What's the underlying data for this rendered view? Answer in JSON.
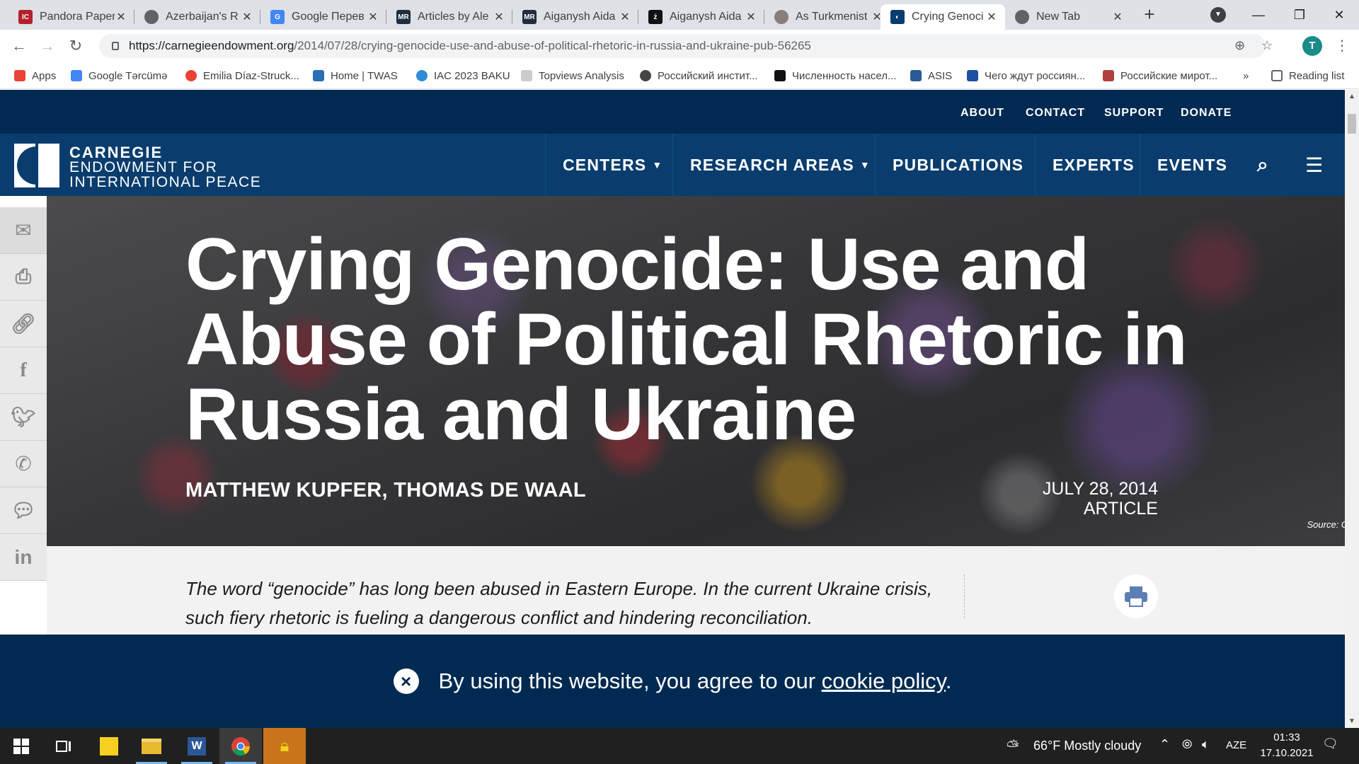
{
  "browser": {
    "tabs": [
      {
        "title": "Pandora Paper",
        "favicon": "ICIJ",
        "color": "#b3202c"
      },
      {
        "title": "Azerbaijan's R",
        "favicon": "globe-icon",
        "color": "#5f6368"
      },
      {
        "title": "Google Перев",
        "favicon": "google-translate-icon",
        "color": "#4285f4"
      },
      {
        "title": "Articles by Ale",
        "favicon": "MR",
        "color": "#1f2d3d"
      },
      {
        "title": "Aiganysh Aida",
        "favicon": "MR",
        "color": "#1f2d3d"
      },
      {
        "title": "Aiganysh Aida",
        "favicon": "ż",
        "color": "#111111"
      },
      {
        "title": "As Turkmenist",
        "favicon": "img",
        "color": "#8a7f78"
      },
      {
        "title": "Crying Genoci",
        "favicon": "carnegie",
        "color": "#0a3d6e",
        "active": true
      },
      {
        "title": "New Tab",
        "favicon": "chrome",
        "color": "#5f6368"
      }
    ],
    "url": {
      "host": "https://carnegieendowment.org",
      "path": "/2014/07/28/crying-genocide-use-and-abuse-of-political-rhetoric-in-russia-and-ukraine-pub-56265"
    },
    "profile_initial": "T",
    "bookmarks": [
      {
        "label": "Apps",
        "color": "#ea4335"
      },
      {
        "label": "Google Tərcümə",
        "color": "#4285f4"
      },
      {
        "label": "Emilia Díaz-Struck...",
        "color": "#ea4335"
      },
      {
        "label": "Home | TWAS",
        "color": "#2a6fb5"
      },
      {
        "label": "IAC 2023 BAKU",
        "color": "#2e8bd8"
      },
      {
        "label": "Topviews Analysis",
        "color": "#cccccc"
      },
      {
        "label": "Российский инстит...",
        "color": "#444444"
      },
      {
        "label": "Численность насел...",
        "color": "#111111"
      },
      {
        "label": "ASIS",
        "color": "#2a5a9a"
      },
      {
        "label": "Чего ждут россиян...",
        "color": "#1f4fa0"
      },
      {
        "label": "Российские мирот...",
        "color": "#b04040"
      }
    ],
    "more_bookmarks": "»",
    "reading_list": "Reading list"
  },
  "site": {
    "utility_links": [
      "ABOUT",
      "CONTACT",
      "SUPPORT",
      "DONATE"
    ],
    "logo": {
      "line1": "CARNEGIE",
      "line2": "ENDOWMENT FOR",
      "line3": "INTERNATIONAL PEACE"
    },
    "nav": [
      {
        "label": "CENTERS",
        "dropdown": true
      },
      {
        "label": "RESEARCH AREAS",
        "dropdown": true
      },
      {
        "label": "PUBLICATIONS",
        "dropdown": false
      },
      {
        "label": "EXPERTS",
        "dropdown": false
      },
      {
        "label": "EVENTS",
        "dropdown": false
      }
    ]
  },
  "article": {
    "title": "Crying Genocide: Use and Abuse of Political Rhetoric in Russia and Ukraine",
    "authors": "MATTHEW KUPFER,  THOMAS DE WAAL",
    "date": "JULY 28, 2014",
    "type": "ARTICLE",
    "image_source": "Source: Getty",
    "summary": "The word “genocide” has long been abused in Eastern Europe. In the current Ukraine crisis, such fiery rhetoric is fueling a dangerous conflict and hindering reconciliation."
  },
  "share_buttons": [
    "email-icon",
    "print-icon",
    "link-icon",
    "facebook-icon",
    "twitter-icon",
    "whatsapp-icon",
    "messenger-icon",
    "linkedin-icon"
  ],
  "cookie_banner": {
    "text_before": "By using this website, you agree to our ",
    "link": "cookie policy",
    "text_after": "."
  },
  "taskbar": {
    "weather": "66°F  Mostly cloudy",
    "language": "AZE",
    "time": "01:33",
    "date": "17.10.2021"
  },
  "colors": {
    "brand_dark": "#002a52",
    "brand": "#0a3d6e"
  }
}
